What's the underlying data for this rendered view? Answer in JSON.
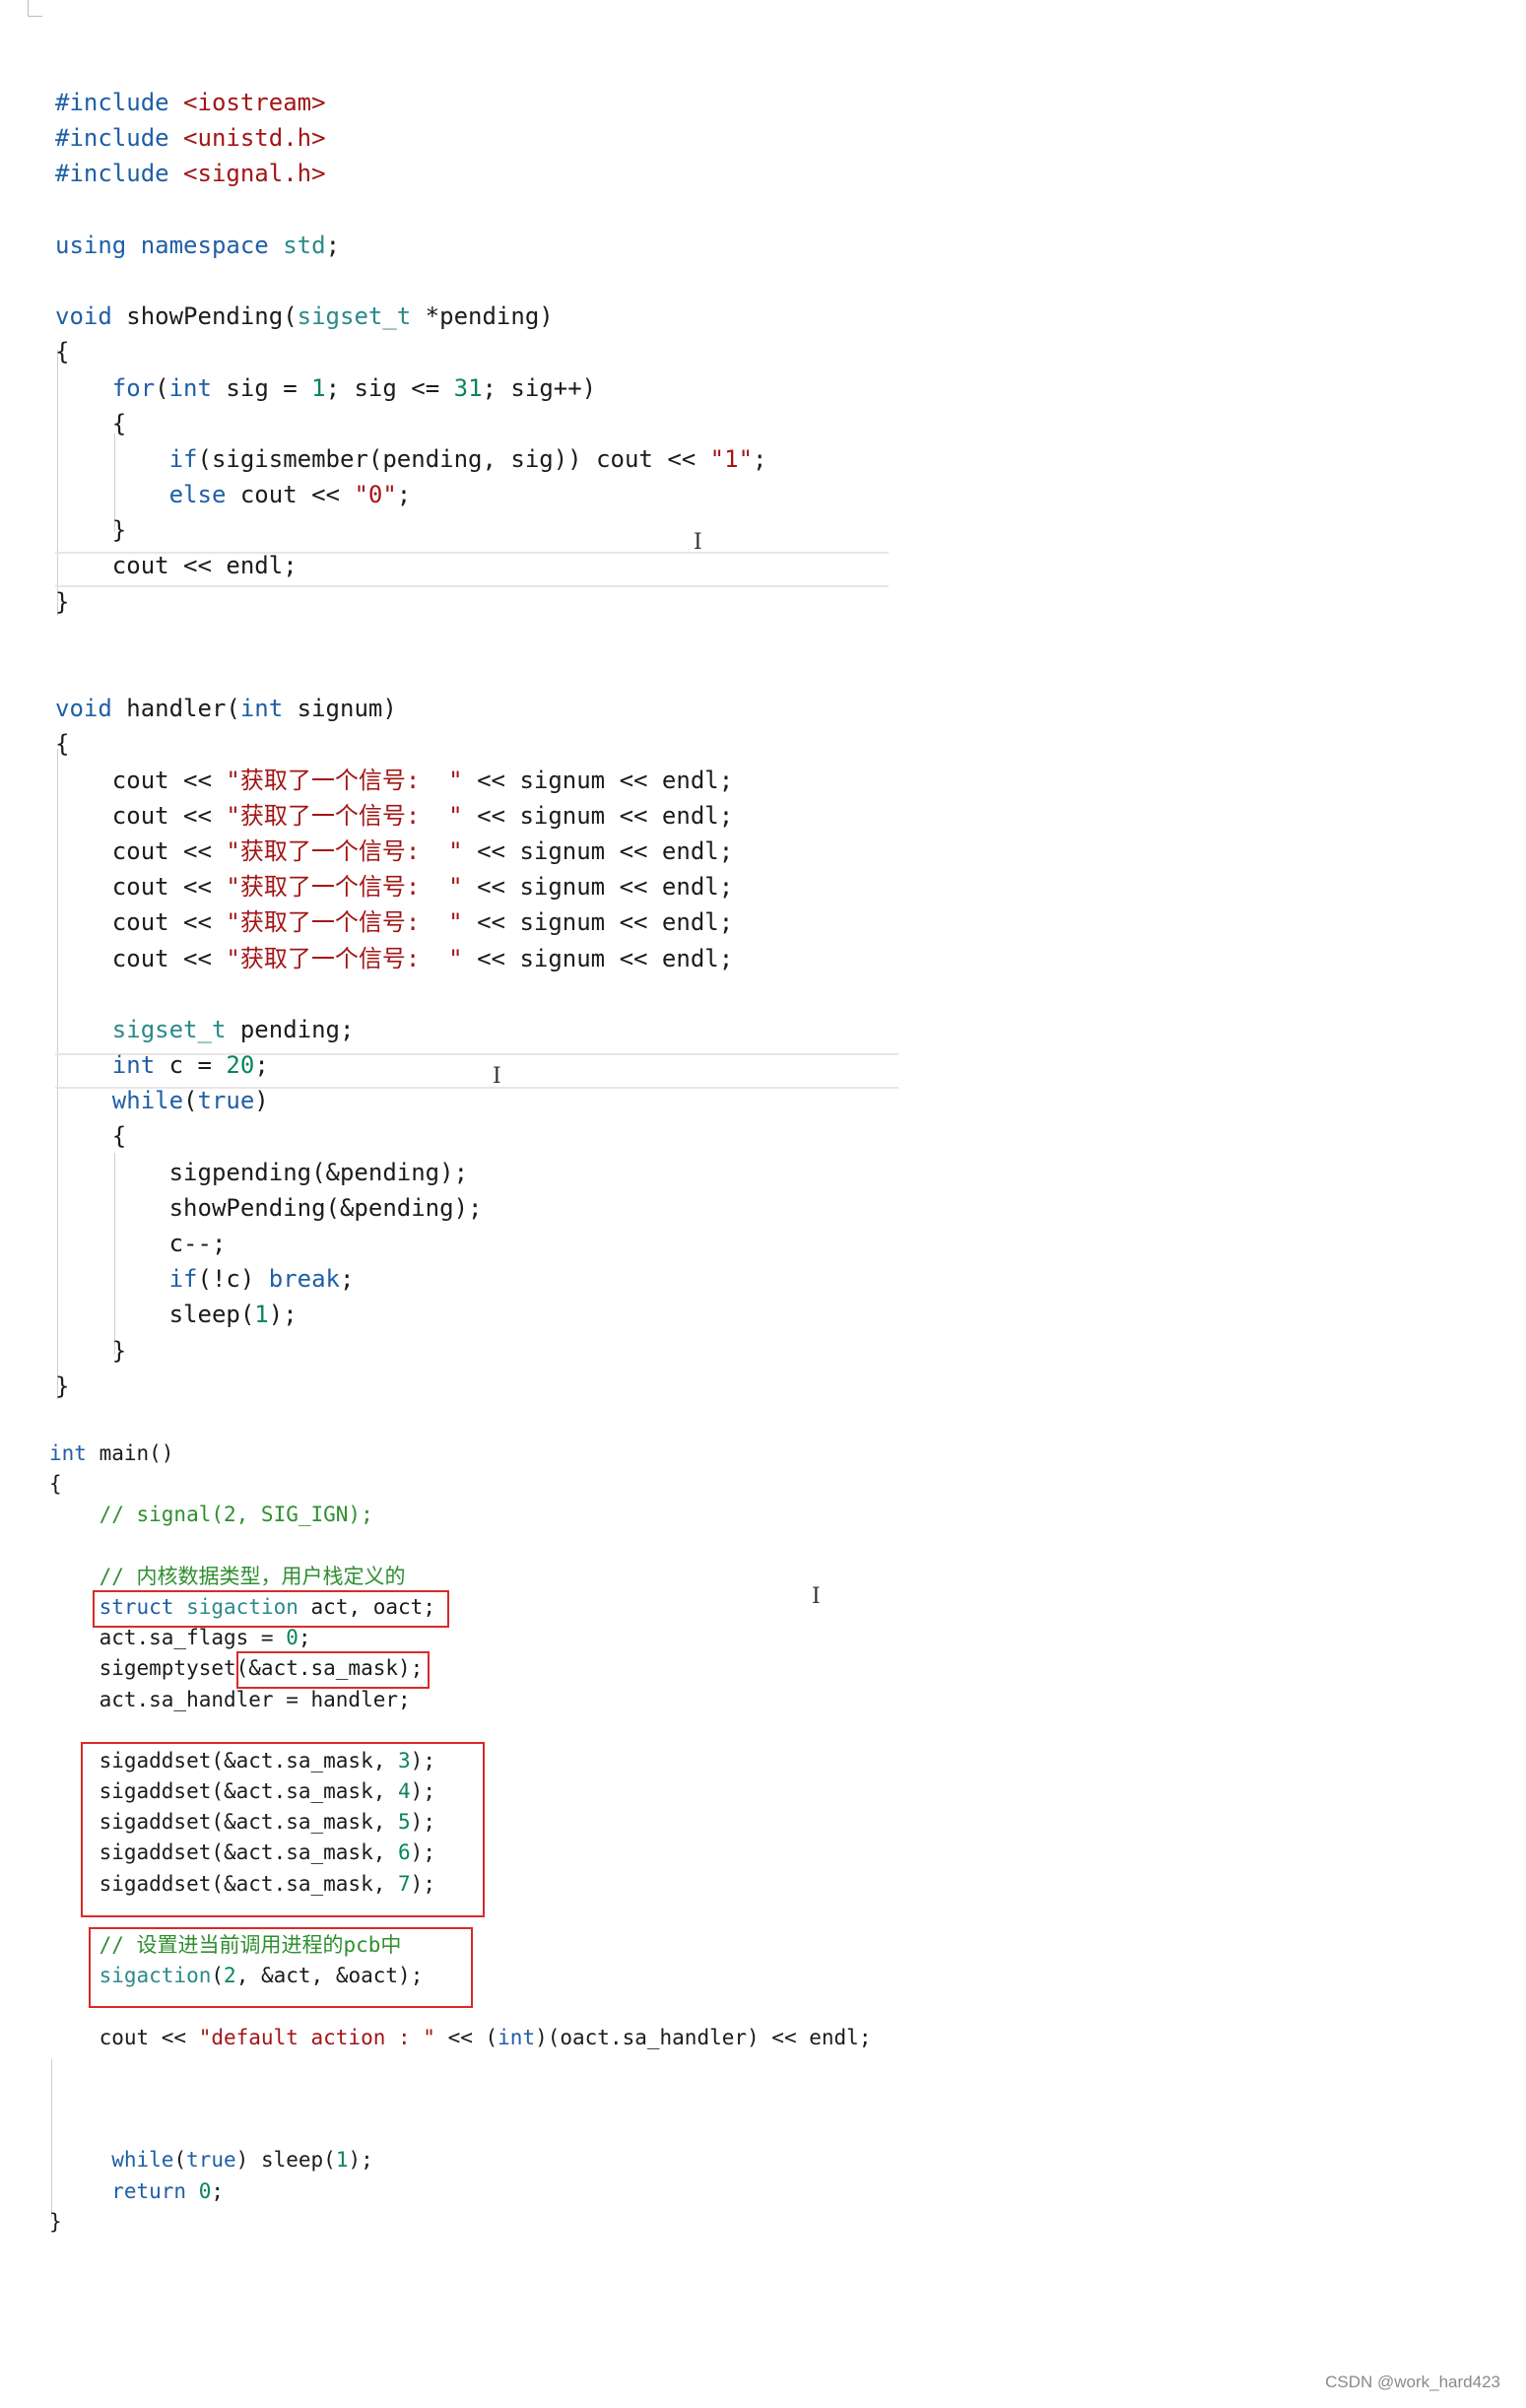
{
  "code_top": [
    "#include <iostream>",
    "#include <unistd.h>",
    "#include <signal.h>",
    "",
    "using namespace std;",
    "",
    "void showPending(sigset_t *pending)",
    "{",
    "    for(int sig = 1; sig <= 31; sig++)",
    "    {",
    "        if(sigismember(pending, sig)) cout << \"1\";",
    "        else cout << \"0\";",
    "    }",
    "    cout << endl;",
    "}",
    "",
    "",
    "void handler(int signum)",
    "{",
    "    cout << \"获取了一个信号:  \" << signum << endl;",
    "    cout << \"获取了一个信号:  \" << signum << endl;",
    "    cout << \"获取了一个信号:  \" << signum << endl;",
    "    cout << \"获取了一个信号:  \" << signum << endl;",
    "    cout << \"获取了一个信号:  \" << signum << endl;",
    "    cout << \"获取了一个信号:  \" << signum << endl;",
    "",
    "    sigset_t pending;",
    "    int c = 20;",
    "    while(true)",
    "    {",
    "        sigpending(&pending);",
    "        showPending(&pending);",
    "        c--;",
    "        if(!c) break;",
    "        sleep(1);",
    "    }",
    "}"
  ],
  "code_main": [
    "int main()",
    "{",
    "    // signal(2, SIG_IGN);",
    "",
    "    // 内核数据类型，用户栈定义的",
    "    struct sigaction act, oact;",
    "    act.sa_flags = 0;",
    "    sigemptyset(&act.sa_mask);",
    "    act.sa_handler = handler;",
    "",
    "    sigaddset(&act.sa_mask, 3);",
    "    sigaddset(&act.sa_mask, 4);",
    "    sigaddset(&act.sa_mask, 5);",
    "    sigaddset(&act.sa_mask, 6);",
    "    sigaddset(&act.sa_mask, 7);",
    "",
    "    // 设置进当前调用进程的pcb中",
    "    sigaction(2, &act, &oact);",
    "",
    "    cout << \"default action : \" << (int)(oact.sa_handler) << endl;",
    "",
    "",
    "",
    "     while(true) sleep(1);",
    "     return 0;",
    "}"
  ],
  "caret_glyph": "I",
  "watermark": "CSDN @work_hard423"
}
